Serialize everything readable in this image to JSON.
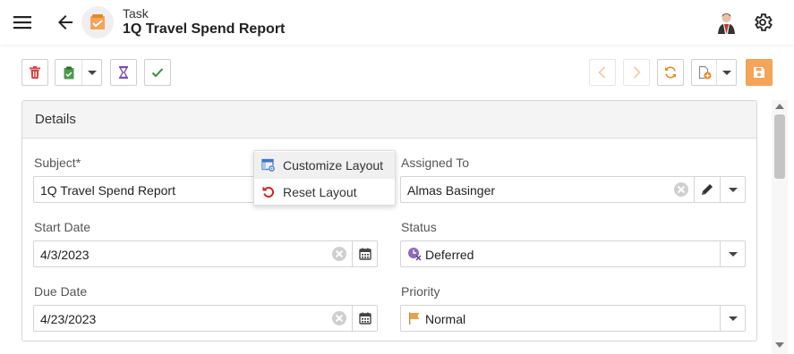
{
  "header": {
    "breadcrumb": "Task",
    "title": "1Q Travel Spend Report",
    "icons": [
      "menu-icon",
      "back-arrow-icon",
      "task-icon",
      "avatar",
      "gear-icon"
    ]
  },
  "toolbar": {
    "left_icons": [
      "delete-icon",
      "clipboard-icon",
      "hourglass-icon",
      "checkmark-icon"
    ],
    "right_icons": [
      "previous-icon",
      "next-icon",
      "refresh-icon",
      "new-document-icon",
      "save-icon"
    ],
    "colors": {
      "delete": "#d64545",
      "clipboard": "#4c9a4c",
      "hourglass": "#7d4fa8",
      "check": "#3c8c3c",
      "nav_disabled": "#f3c9a0",
      "refresh": "#e38b22",
      "save_bg": "#f5a45a"
    }
  },
  "details": {
    "heading": "Details",
    "subject": {
      "label": "Subject*",
      "value": "1Q Travel Spend Report"
    },
    "assigned_to": {
      "label": "Assigned To",
      "value": "Almas Basinger"
    },
    "start_date": {
      "label": "Start Date",
      "value": "4/3/2023"
    },
    "status": {
      "label": "Status",
      "value": "Deferred"
    },
    "due_date": {
      "label": "Due Date",
      "value": "4/23/2023"
    },
    "priority": {
      "label": "Priority",
      "value": "Normal"
    }
  },
  "context_menu": {
    "items": [
      {
        "label": "Customize Layout",
        "icon": "customize-layout-icon"
      },
      {
        "label": "Reset Layout",
        "icon": "reset-layout-icon"
      }
    ]
  }
}
